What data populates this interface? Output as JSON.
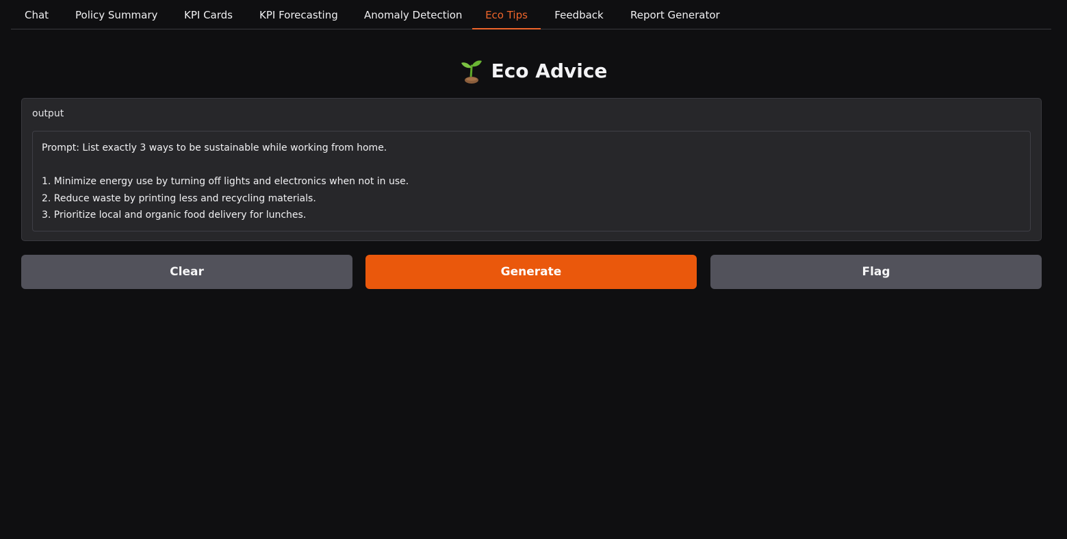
{
  "tabs": [
    {
      "label": "Chat",
      "active": false
    },
    {
      "label": "Policy Summary",
      "active": false
    },
    {
      "label": "KPI Cards",
      "active": false
    },
    {
      "label": "KPI Forecasting",
      "active": false
    },
    {
      "label": "Anomaly Detection",
      "active": false
    },
    {
      "label": "Eco Tips",
      "active": true
    },
    {
      "label": "Feedback",
      "active": false
    },
    {
      "label": "Report Generator",
      "active": false
    }
  ],
  "page": {
    "icon": "sprout-icon",
    "title": "Eco Advice"
  },
  "output": {
    "label": "output",
    "text": "Prompt: List exactly 3 ways to be sustainable while working from home.\n\n1. Minimize energy use by turning off lights and electronics when not in use.\n2. Reduce waste by printing less and recycling materials.\n3. Prioritize local and organic food delivery for lunches."
  },
  "buttons": {
    "clear": "Clear",
    "generate": "Generate",
    "flag": "Flag"
  },
  "colors": {
    "accent": "#ea580c",
    "active_tab": "#f0652b",
    "background": "#0f0f11",
    "panel": "#27272a",
    "secondary_button": "#52525b"
  }
}
